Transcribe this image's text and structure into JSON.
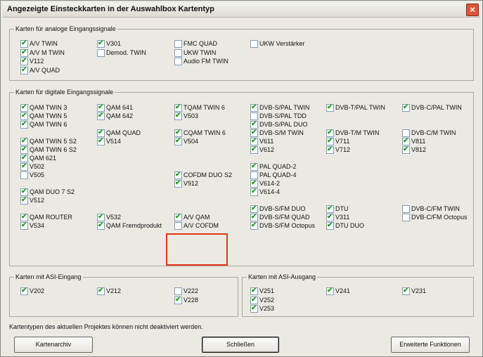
{
  "title": "Angezeigte Einsteckkarten in der Auswahlbox Kartentyp",
  "groups": {
    "analog": "Karten für analoge Eingangssignale",
    "digital": "Karten für digitale Eingangssignale",
    "asi_in": "Karten mit ASI-Eingang",
    "asi_out": "Karten mit ASI-Ausgang"
  },
  "checkboxes": [
    {
      "label": "A/V TWIN",
      "checked": true,
      "g": "a",
      "c": 0,
      "r": 0
    },
    {
      "label": "A/V M TWIN",
      "checked": true,
      "g": "a",
      "c": 0,
      "r": 1
    },
    {
      "label": "V112",
      "checked": true,
      "g": "a",
      "c": 0,
      "r": 2
    },
    {
      "label": "A/V QUAD",
      "checked": true,
      "g": "a",
      "c": 0,
      "r": 3
    },
    {
      "label": "V301",
      "checked": true,
      "g": "a",
      "c": 1,
      "r": 0
    },
    {
      "label": "Demod. TWIN",
      "checked": false,
      "g": "a",
      "c": 1,
      "r": 1
    },
    {
      "label": "FMC QUAD",
      "checked": false,
      "g": "a",
      "c": 2,
      "r": 0
    },
    {
      "label": "UKW TWIN",
      "checked": false,
      "g": "a",
      "c": 2,
      "r": 1
    },
    {
      "label": "Audio FM TWIN",
      "checked": false,
      "g": "a",
      "c": 2,
      "r": 2
    },
    {
      "label": "UKW Verstärker",
      "checked": false,
      "g": "a",
      "c": 3,
      "r": 0
    },
    {
      "label": "QAM TWIN 3",
      "checked": true,
      "g": "d",
      "c": 0,
      "r": 0
    },
    {
      "label": "QAM TWIN 5",
      "checked": true,
      "g": "d",
      "c": 0,
      "r": 1
    },
    {
      "label": "QAM TWIN 6",
      "checked": true,
      "g": "d",
      "c": 0,
      "r": 2
    },
    {
      "label": "QAM TWIN 5 S2",
      "checked": true,
      "g": "d",
      "c": 0,
      "r": 4
    },
    {
      "label": "QAM TWIN 6 S2",
      "checked": true,
      "g": "d",
      "c": 0,
      "r": 5
    },
    {
      "label": "QAM 621",
      "checked": true,
      "g": "d",
      "c": 0,
      "r": 6
    },
    {
      "label": "V502",
      "checked": true,
      "g": "d",
      "c": 0,
      "r": 7
    },
    {
      "label": "V505",
      "checked": false,
      "g": "d",
      "c": 0,
      "r": 8
    },
    {
      "label": "QAM DUO 7 S2",
      "checked": true,
      "g": "d",
      "c": 0,
      "r": 10
    },
    {
      "label": "V512",
      "checked": true,
      "g": "d",
      "c": 0,
      "r": 11
    },
    {
      "label": "QAM ROUTER",
      "checked": true,
      "g": "d",
      "c": 0,
      "r": 13
    },
    {
      "label": "V534",
      "checked": true,
      "g": "d",
      "c": 0,
      "r": 14
    },
    {
      "label": "QAM 641",
      "checked": true,
      "g": "d",
      "c": 1,
      "r": 0
    },
    {
      "label": "QAM 642",
      "checked": true,
      "g": "d",
      "c": 1,
      "r": 1
    },
    {
      "label": "QAM QUAD",
      "checked": true,
      "g": "d",
      "c": 1,
      "r": 3
    },
    {
      "label": "V514",
      "checked": true,
      "g": "d",
      "c": 1,
      "r": 4
    },
    {
      "label": "V532",
      "checked": true,
      "g": "d",
      "c": 1,
      "r": 13
    },
    {
      "label": "QAM Fremdprodukt",
      "checked": true,
      "g": "d",
      "c": 1,
      "r": 14
    },
    {
      "label": "TQAM TWIN 6",
      "checked": true,
      "g": "d",
      "c": 2,
      "r": 0
    },
    {
      "label": "V503",
      "checked": true,
      "g": "d",
      "c": 2,
      "r": 1
    },
    {
      "label": "CQAM TWIN 6",
      "checked": true,
      "g": "d",
      "c": 2,
      "r": 3
    },
    {
      "label": "V504",
      "checked": true,
      "g": "d",
      "c": 2,
      "r": 4
    },
    {
      "label": "COFDM DUO S2",
      "checked": true,
      "g": "d",
      "c": 2,
      "r": 8
    },
    {
      "label": "V912",
      "checked": true,
      "g": "d",
      "c": 2,
      "r": 9
    },
    {
      "label": "A/V QAM",
      "checked": true,
      "g": "d",
      "c": 2,
      "r": 13
    },
    {
      "label": "A/V COFDM",
      "checked": false,
      "g": "d",
      "c": 2,
      "r": 14
    },
    {
      "label": "DVB-S/PAL TWIN",
      "checked": true,
      "g": "d",
      "c": 3,
      "r": 0
    },
    {
      "label": "DVB-S/PAL TDD",
      "checked": false,
      "g": "d",
      "c": 3,
      "r": 1
    },
    {
      "label": "DVB-S/PAL DUO",
      "checked": true,
      "g": "d",
      "c": 3,
      "r": 2
    },
    {
      "label": "DVB-S/M TWIN",
      "checked": true,
      "g": "d",
      "c": 3,
      "r": 3
    },
    {
      "label": "V611",
      "checked": true,
      "g": "d",
      "c": 3,
      "r": 4
    },
    {
      "label": "V612",
      "checked": true,
      "g": "d",
      "c": 3,
      "r": 5
    },
    {
      "label": "PAL QUAD-2",
      "checked": true,
      "g": "d",
      "c": 3,
      "r": 7
    },
    {
      "label": "PAL QUAD-4",
      "checked": false,
      "g": "d",
      "c": 3,
      "r": 8
    },
    {
      "label": "V614-2",
      "checked": true,
      "g": "d",
      "c": 3,
      "r": 9
    },
    {
      "label": "V614-4",
      "checked": true,
      "g": "d",
      "c": 3,
      "r": 10
    },
    {
      "label": "DVB-S/FM DUO",
      "checked": true,
      "g": "d",
      "c": 3,
      "r": 12
    },
    {
      "label": "DVB-S/FM QUAD",
      "checked": true,
      "g": "d",
      "c": 3,
      "r": 13
    },
    {
      "label": "DVB-S/FM Octopus",
      "checked": true,
      "g": "d",
      "c": 3,
      "r": 14
    },
    {
      "label": "DVB-T/PAL TWIN",
      "checked": true,
      "g": "d",
      "c": 4,
      "r": 0
    },
    {
      "label": "DVB-T/M TWIN",
      "checked": true,
      "g": "d",
      "c": 4,
      "r": 3
    },
    {
      "label": "V711",
      "checked": true,
      "g": "d",
      "c": 4,
      "r": 4
    },
    {
      "label": "V712",
      "checked": true,
      "g": "d",
      "c": 4,
      "r": 5
    },
    {
      "label": "DTU",
      "checked": true,
      "g": "d",
      "c": 4,
      "r": 12
    },
    {
      "label": "V311",
      "checked": true,
      "g": "d",
      "c": 4,
      "r": 13
    },
    {
      "label": "DTU DUO",
      "checked": true,
      "g": "d",
      "c": 4,
      "r": 14
    },
    {
      "label": "DVB-C/PAL TWIN",
      "checked": true,
      "g": "d",
      "c": 5,
      "r": 0
    },
    {
      "label": "DVB-C/M TWIN",
      "checked": false,
      "g": "d",
      "c": 5,
      "r": 3
    },
    {
      "label": "V811",
      "checked": true,
      "g": "d",
      "c": 5,
      "r": 4
    },
    {
      "label": "V812",
      "checked": true,
      "g": "d",
      "c": 5,
      "r": 5
    },
    {
      "label": "DVB-C/FM TWIN",
      "checked": false,
      "g": "d",
      "c": 5,
      "r": 12
    },
    {
      "label": "DVB-C/FM Octopus",
      "checked": false,
      "g": "d",
      "c": 5,
      "r": 13
    },
    {
      "label": "V202",
      "checked": true,
      "g": "i",
      "c": 0,
      "r": 0
    },
    {
      "label": "V212",
      "checked": true,
      "g": "i",
      "c": 1,
      "r": 0
    },
    {
      "label": "V222",
      "checked": false,
      "g": "i",
      "c": 2,
      "r": 0
    },
    {
      "label": "V228",
      "checked": true,
      "g": "i",
      "c": 2,
      "r": 1
    },
    {
      "label": "V251",
      "checked": true,
      "g": "o",
      "c": 0,
      "r": 0
    },
    {
      "label": "V252",
      "checked": true,
      "g": "o",
      "c": 0,
      "r": 1
    },
    {
      "label": "V253",
      "checked": true,
      "g": "o",
      "c": 0,
      "r": 2
    },
    {
      "label": "V241",
      "checked": true,
      "g": "o",
      "c": 1,
      "r": 0
    },
    {
      "label": "V231",
      "checked": true,
      "g": "o",
      "c": 2,
      "r": 0
    }
  ],
  "note": "Kartentypen des aktuellen Projektes können nicht deaktiviert werden.",
  "buttons": {
    "archive": "Kartenarchiv",
    "close": "Schließen",
    "extended": "Erweiterte Funktionen"
  },
  "checkmark_color": "#21a121",
  "highlight_color": "#e0351c"
}
